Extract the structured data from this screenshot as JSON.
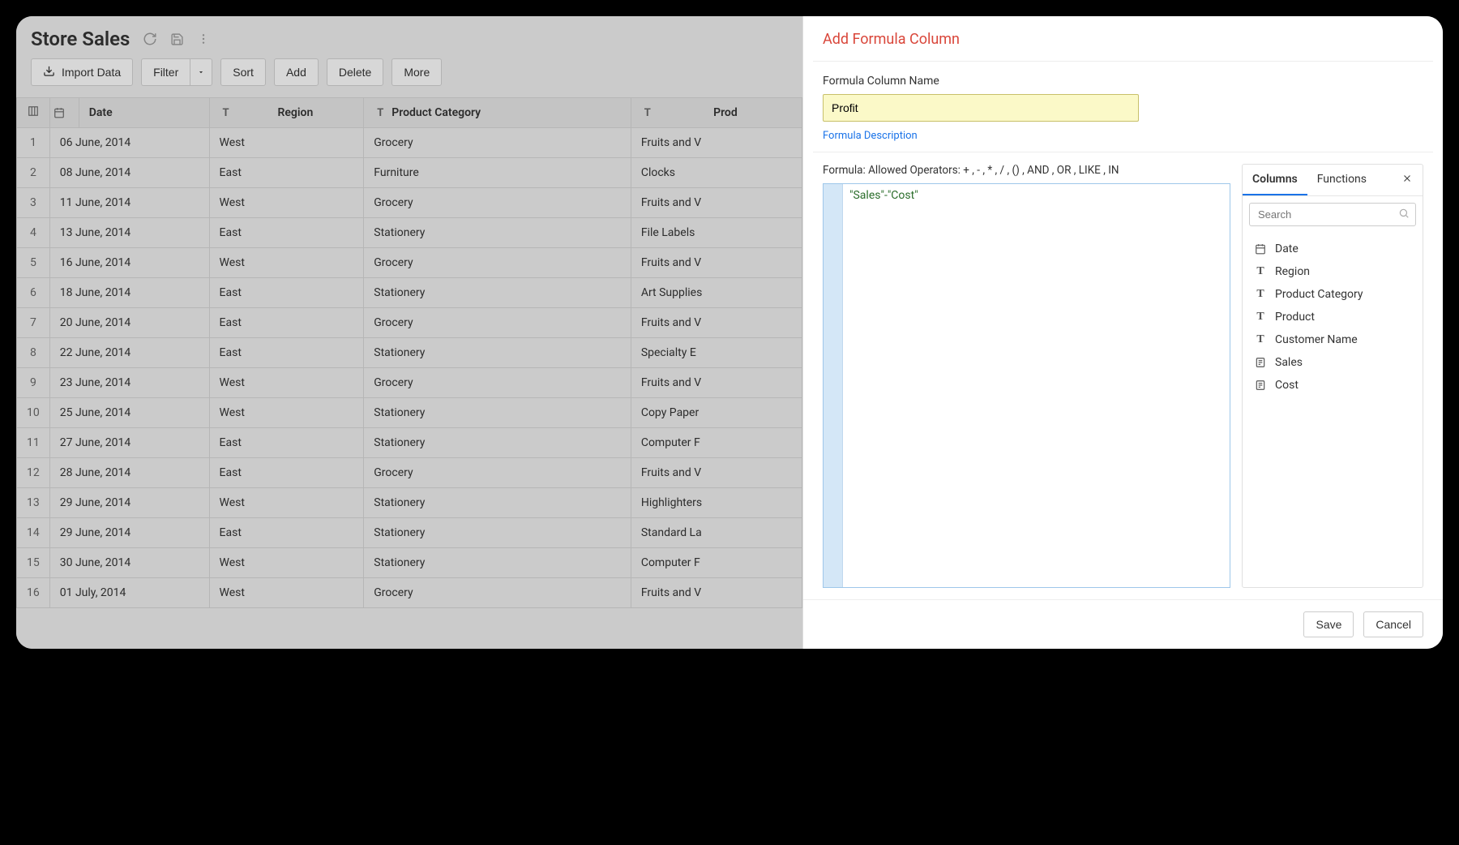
{
  "header": {
    "title": "Store Sales"
  },
  "toolbar": {
    "import": "Import Data",
    "filter": "Filter",
    "sort": "Sort",
    "add": "Add",
    "delete": "Delete",
    "more": "More"
  },
  "table": {
    "columns": [
      {
        "label": "Date",
        "type": "date"
      },
      {
        "label": "Region",
        "type": "text"
      },
      {
        "label": "Product Category",
        "type": "text"
      },
      {
        "label": "Prod",
        "type": "text"
      }
    ],
    "rows": [
      {
        "n": "1",
        "date": "06 June, 2014",
        "region": "West",
        "cat": "Grocery",
        "prod": "Fruits and V"
      },
      {
        "n": "2",
        "date": "08 June, 2014",
        "region": "East",
        "cat": "Furniture",
        "prod": "Clocks"
      },
      {
        "n": "3",
        "date": "11 June, 2014",
        "region": "West",
        "cat": "Grocery",
        "prod": "Fruits and V"
      },
      {
        "n": "4",
        "date": "13 June, 2014",
        "region": "East",
        "cat": "Stationery",
        "prod": "File Labels"
      },
      {
        "n": "5",
        "date": "16 June, 2014",
        "region": "West",
        "cat": "Grocery",
        "prod": "Fruits and V"
      },
      {
        "n": "6",
        "date": "18 June, 2014",
        "region": "East",
        "cat": "Stationery",
        "prod": "Art Supplies"
      },
      {
        "n": "7",
        "date": "20 June, 2014",
        "region": "East",
        "cat": "Grocery",
        "prod": "Fruits and V"
      },
      {
        "n": "8",
        "date": "22 June, 2014",
        "region": "East",
        "cat": "Stationery",
        "prod": "Specialty E"
      },
      {
        "n": "9",
        "date": "23 June, 2014",
        "region": "West",
        "cat": "Grocery",
        "prod": "Fruits and V"
      },
      {
        "n": "10",
        "date": "25 June, 2014",
        "region": "West",
        "cat": "Stationery",
        "prod": "Copy Paper"
      },
      {
        "n": "11",
        "date": "27 June, 2014",
        "region": "East",
        "cat": "Stationery",
        "prod": "Computer F"
      },
      {
        "n": "12",
        "date": "28 June, 2014",
        "region": "East",
        "cat": "Grocery",
        "prod": "Fruits and V"
      },
      {
        "n": "13",
        "date": "29 June, 2014",
        "region": "West",
        "cat": "Stationery",
        "prod": "Highlighters"
      },
      {
        "n": "14",
        "date": "29 June, 2014",
        "region": "East",
        "cat": "Stationery",
        "prod": "Standard La"
      },
      {
        "n": "15",
        "date": "30 June, 2014",
        "region": "West",
        "cat": "Stationery",
        "prod": "Computer F"
      },
      {
        "n": "16",
        "date": "01 July, 2014",
        "region": "West",
        "cat": "Grocery",
        "prod": "Fruits and V"
      }
    ]
  },
  "panel": {
    "title": "Add Formula Column",
    "name_label": "Formula Column Name",
    "name_value": "Profit",
    "desc_link": "Formula Description",
    "formula_hint": "Formula: Allowed Operators: + , - , * , / , () , AND , OR , LIKE , IN",
    "formula_text": "\"Sales\"-\"Cost\"",
    "tabs": {
      "columns": "Columns",
      "functions": "Functions"
    },
    "search_placeholder": "Search",
    "columns": [
      {
        "label": "Date",
        "type": "date"
      },
      {
        "label": "Region",
        "type": "text"
      },
      {
        "label": "Product Category",
        "type": "text"
      },
      {
        "label": "Product",
        "type": "text"
      },
      {
        "label": "Customer Name",
        "type": "text"
      },
      {
        "label": "Sales",
        "type": "number"
      },
      {
        "label": "Cost",
        "type": "number"
      }
    ],
    "save": "Save",
    "cancel": "Cancel"
  }
}
